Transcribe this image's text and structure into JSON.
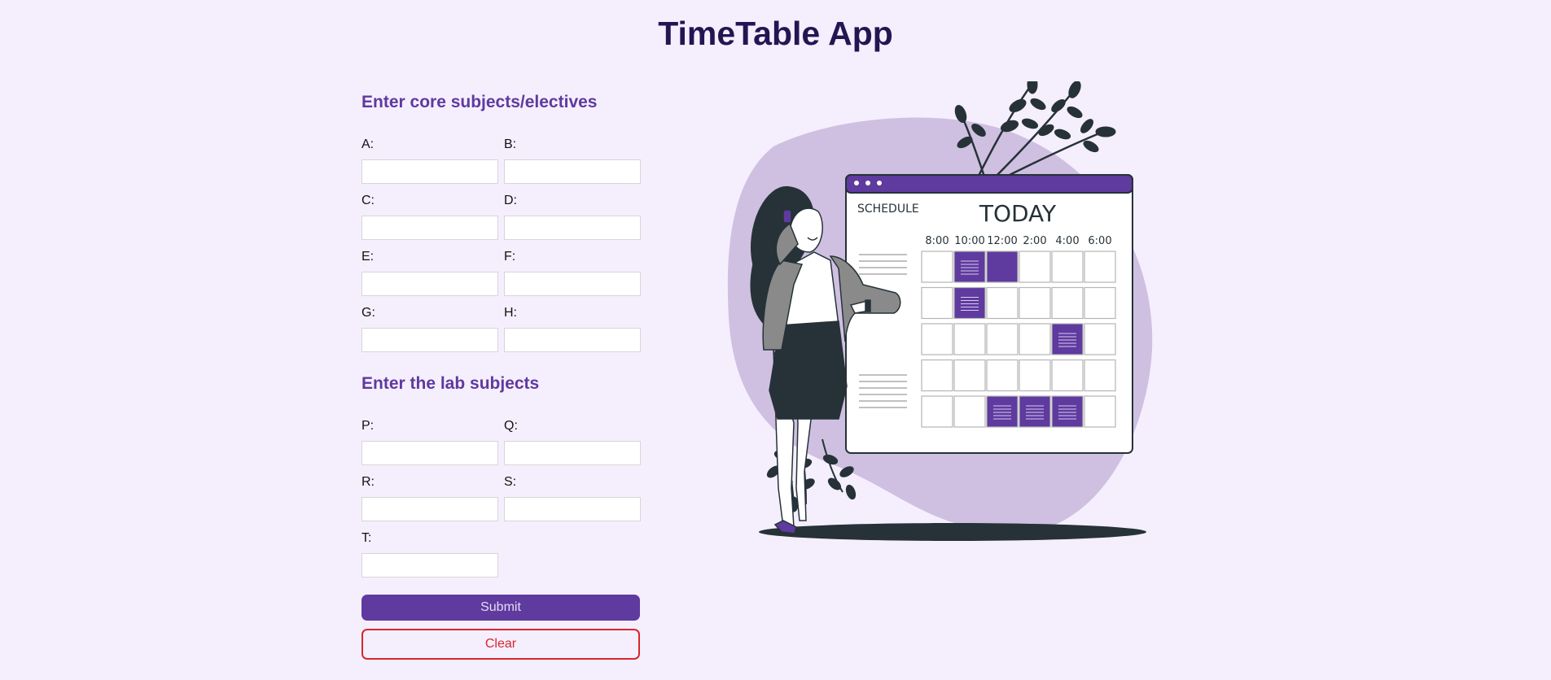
{
  "app": {
    "title": "TimeTable App"
  },
  "core": {
    "heading": "Enter core subjects/electives",
    "fields": [
      {
        "label": "A:",
        "value": ""
      },
      {
        "label": "B:",
        "value": ""
      },
      {
        "label": "C:",
        "value": ""
      },
      {
        "label": "D:",
        "value": ""
      },
      {
        "label": "E:",
        "value": ""
      },
      {
        "label": "F:",
        "value": ""
      },
      {
        "label": "G:",
        "value": ""
      },
      {
        "label": "H:",
        "value": ""
      }
    ]
  },
  "lab": {
    "heading": "Enter the lab subjects",
    "fields": [
      {
        "label": "P:",
        "value": ""
      },
      {
        "label": "Q:",
        "value": ""
      },
      {
        "label": "R:",
        "value": ""
      },
      {
        "label": "S:",
        "value": ""
      },
      {
        "label": "T:",
        "value": ""
      }
    ]
  },
  "buttons": {
    "submit": "Submit",
    "clear": "Clear"
  },
  "illustration": {
    "schedule_label": "SCHEDULE",
    "today_label": "TODAY",
    "times": [
      "8:00",
      "10:00",
      "12:00",
      "2:00",
      "4:00",
      "6:00"
    ],
    "filled_cells": [
      [
        0,
        1
      ],
      [
        0,
        2
      ],
      [
        1,
        1
      ],
      [
        2,
        4
      ],
      [
        4,
        2
      ],
      [
        4,
        3
      ],
      [
        4,
        4
      ]
    ]
  },
  "colors": {
    "accent": "#5f3a9f",
    "title": "#221652",
    "background": "#f5effd",
    "danger": "#d8262d",
    "blob": "#cfc0e2",
    "dark": "#263238"
  }
}
